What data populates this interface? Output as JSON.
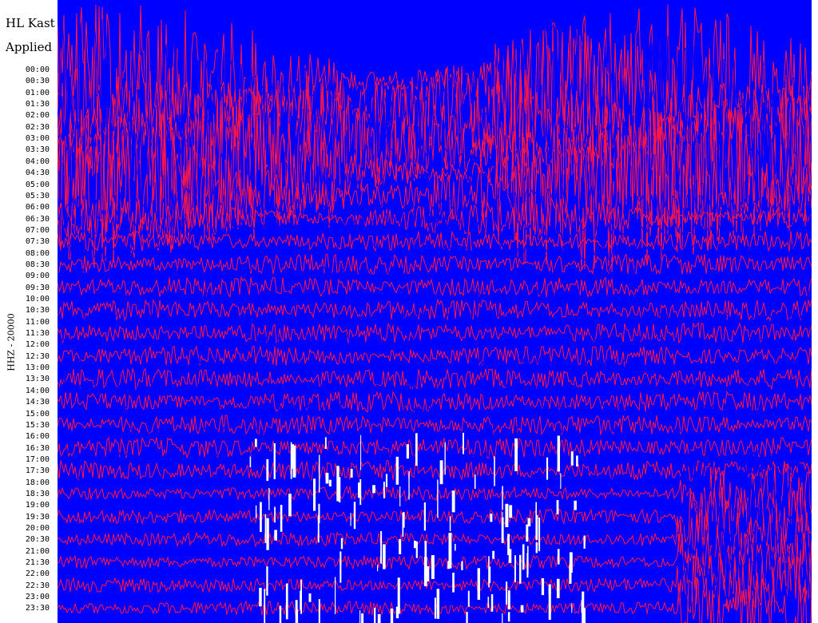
{
  "header": {
    "station_title": "HL Kast",
    "filter_note": "Applied"
  },
  "channel_label": "HHZ - 20000",
  "colors": {
    "trace_a": "#0000ff",
    "trace_b": "#ff1744",
    "background": "#ffffff"
  },
  "chart_data": {
    "type": "line",
    "title": "HL Kast",
    "subtitle": "Applied",
    "ylabel": "HHZ - 20000",
    "x_range": [
      0,
      30
    ],
    "y_tick_labels": [
      "00:00",
      "00:30",
      "01:00",
      "01:30",
      "02:00",
      "02:30",
      "03:00",
      "03:30",
      "04:00",
      "04:30",
      "05:00",
      "05:30",
      "06:00",
      "06:30",
      "07:00",
      "07:30",
      "08:00",
      "08:30",
      "09:00",
      "09:30",
      "10:00",
      "10:30",
      "11:00",
      "11:30",
      "12:00",
      "12:30",
      "13:00",
      "13:30",
      "14:00",
      "14:30",
      "15:00",
      "15:30",
      "16:00",
      "16:30",
      "17:00",
      "17:30",
      "18:00",
      "18:30",
      "19:00",
      "19:30",
      "20:00",
      "20:30",
      "21:00",
      "21:30",
      "22:00",
      "22:30",
      "23:00",
      "23:30"
    ],
    "series_colors_alternating": [
      "#0000ff",
      "#ff1744"
    ],
    "grid": false
  }
}
